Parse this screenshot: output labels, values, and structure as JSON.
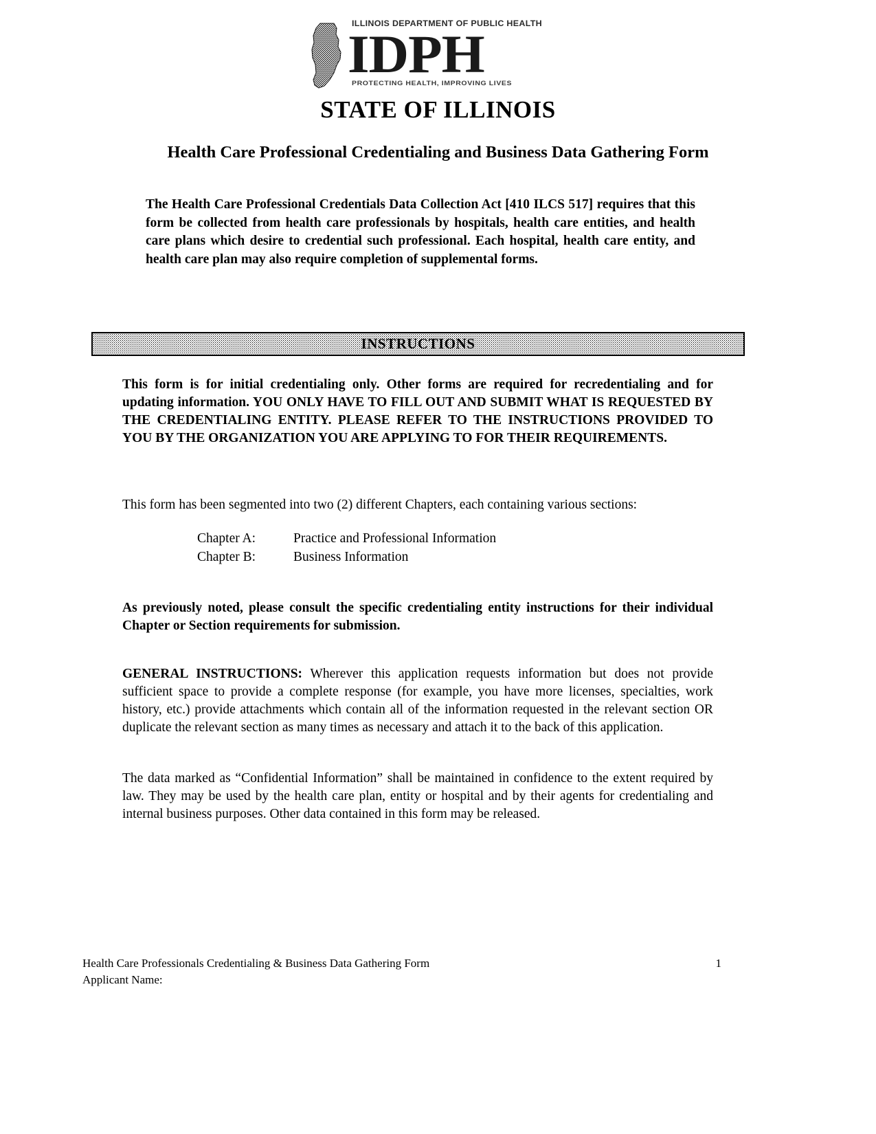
{
  "logo": {
    "top_text": "ILLINOIS DEPARTMENT OF PUBLIC HEALTH",
    "wordmark": "IDPH",
    "tagline": "PROTECTING HEALTH, IMPROVING LIVES",
    "state_outline_icon": "illinois-state-outline-icon"
  },
  "titles": {
    "state": "STATE OF ILLINOIS",
    "form": "Health Care Professional Credentialing and Business Data Gathering Form"
  },
  "intro": {
    "paragraph": "The Health Care Professional Credentials Data Collection Act [410 ILCS 517] requires that this form be collected from health care professionals by hospitals, health care entities, and health care plans which desire to credential such professional. Each hospital, health care entity, and health care plan may also require completion of supplemental forms."
  },
  "instructions_banner": {
    "label": "INSTRUCTIONS"
  },
  "instructions": {
    "intro_bold": "This form is for initial credentialing only. Other forms are required for recredentialing and for updating information. YOU ONLY HAVE TO FILL OUT AND SUBMIT WHAT IS REQUESTED BY THE CREDENTIALING ENTITY. PLEASE REFER TO THE INSTRUCTIONS PROVIDED TO YOU BY THE ORGANIZATION YOU ARE APPLYING TO FOR THEIR REQUIREMENTS.",
    "segmented": "This form has been segmented into two (2) different Chapters, each containing various sections:",
    "chapters": [
      {
        "label": "Chapter A:",
        "value": "Practice and Professional Information"
      },
      {
        "label": "Chapter B:",
        "value": "Business Information"
      }
    ],
    "previously_noted": "As previously noted, please consult the specific credentialing entity instructions for their individual Chapter or Section requirements for submission.",
    "general_heading": "GENERAL INSTRUCTIONS:",
    "general_body": " Wherever this application requests information but does not provide sufficient space to provide a complete response (for example, you have more licenses, specialties, work history, etc.) provide attachments which contain all of the information requested in the relevant section OR duplicate the relevant section as many times as necessary and attach it to the back of this application.",
    "confidential": "The data marked as “Confidential Information” shall be maintained in confidence to the extent required by law. They may be used by the health care plan, entity or hospital and by their agents for credentialing and internal business purposes. Other data contained in this form may be released."
  },
  "footer": {
    "title": "Health Care Professionals Credentialing & Business Data Gathering Form",
    "page_number": "1",
    "applicant_name_label": "Applicant Name:"
  },
  "colors": {
    "text": "#000000",
    "banner_border": "#000000",
    "page_background": "#ffffff"
  }
}
